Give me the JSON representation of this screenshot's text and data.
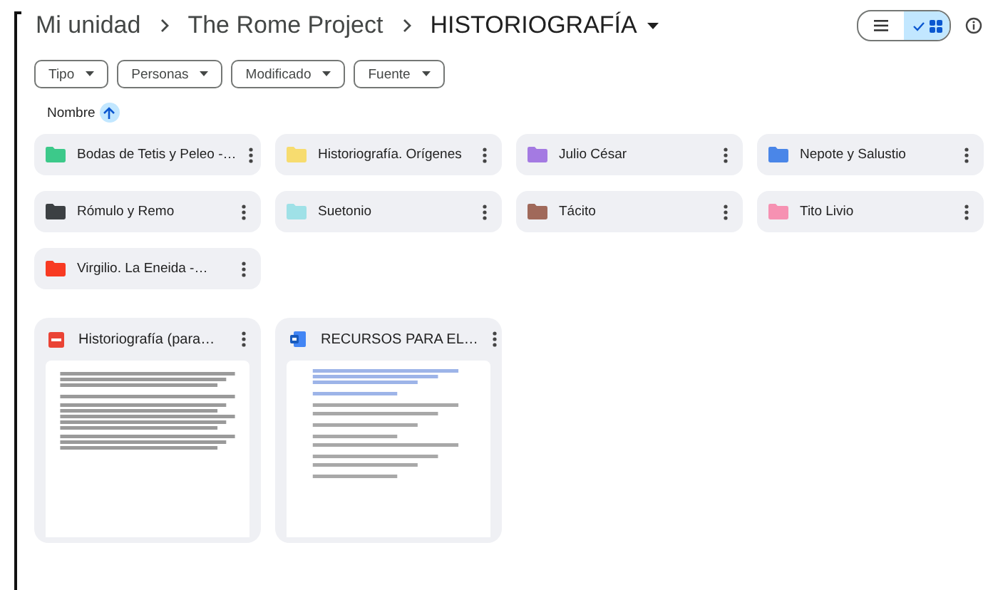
{
  "breadcrumb": [
    {
      "label": "Mi unidad",
      "current": false
    },
    {
      "label": "The Rome Project",
      "current": false
    },
    {
      "label": "HISTORIOGRAFÍA",
      "current": true
    }
  ],
  "view_toggle": [
    {
      "kind": "list",
      "selected": false
    },
    {
      "kind": "grid",
      "selected": true
    }
  ],
  "filters": [
    "Tipo",
    "Personas",
    "Modificado",
    "Fuente"
  ],
  "sort": {
    "label": "Nombre",
    "ascending": true
  },
  "folders": [
    {
      "name": "Bodas de Tetis y Peleo -…",
      "color": "#3cc98a"
    },
    {
      "name": "Historiografía. Orígenes",
      "color": "#f7dc6f"
    },
    {
      "name": "Julio César",
      "color": "#a47ae2"
    },
    {
      "name": "Nepote y Salustio",
      "color": "#4a86e8"
    },
    {
      "name": "Rómulo y Remo",
      "color": "#3c4043"
    },
    {
      "name": "Suetonio",
      "color": "#9fe1e7"
    },
    {
      "name": "Tácito",
      "color": "#a0695a"
    },
    {
      "name": "Tito Livio",
      "color": "#f691b2"
    },
    {
      "name": "Virgilio. La Eneida -…",
      "color": "#f83a22"
    }
  ],
  "files": [
    {
      "name": "Historiografía (para…",
      "kind": "pdf"
    },
    {
      "name": "RECURSOS PARA EL…",
      "kind": "doc"
    }
  ]
}
